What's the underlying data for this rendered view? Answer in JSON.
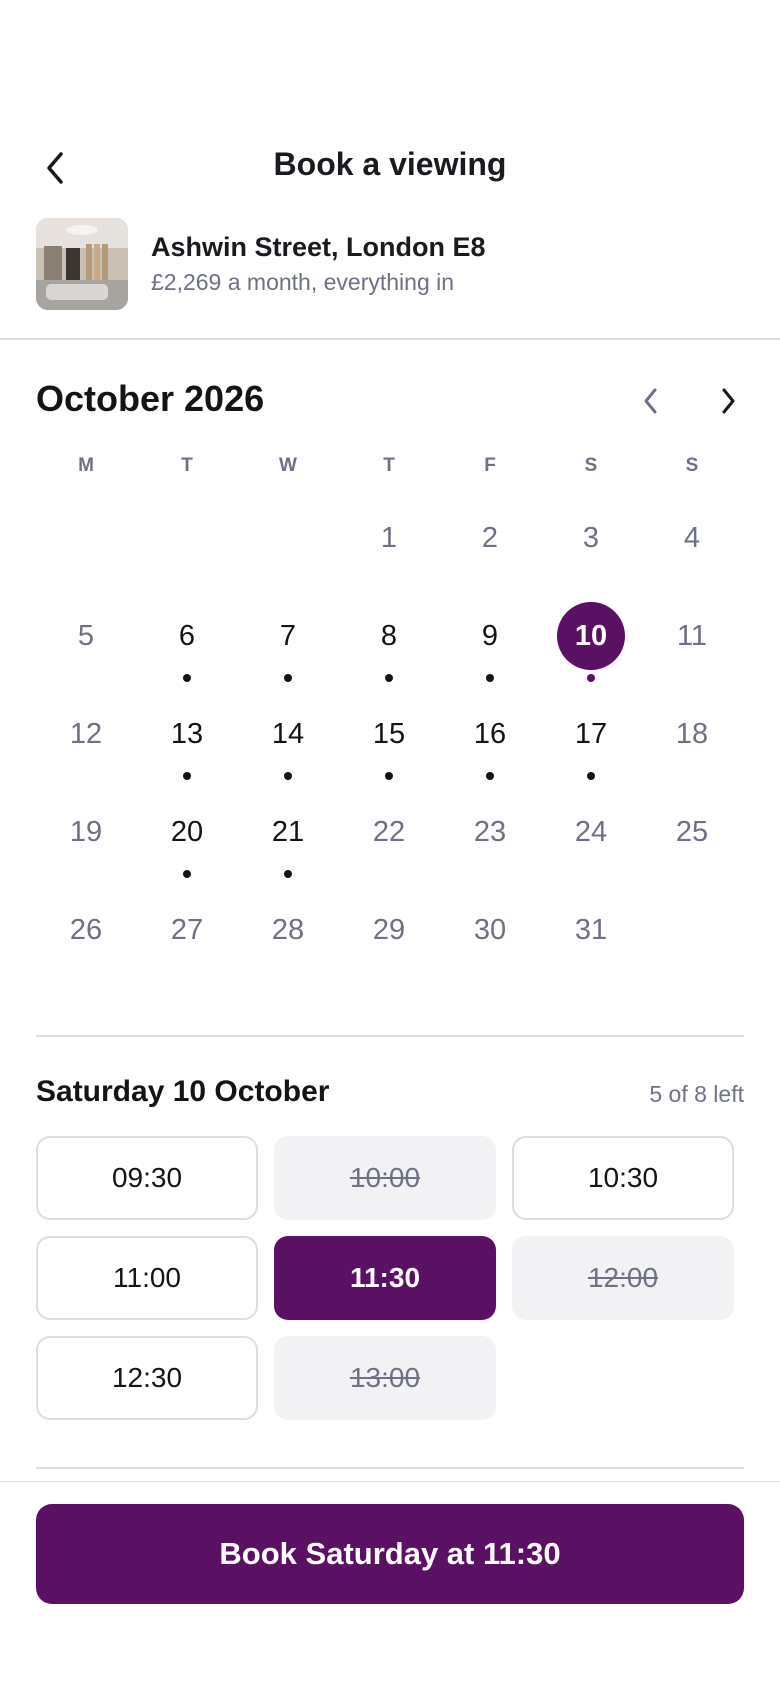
{
  "header": {
    "title": "Book a viewing"
  },
  "listing": {
    "title": "Ashwin Street, London E8",
    "subtitle": "£2,269 a month, everything in"
  },
  "calendar": {
    "month_label": "October 2026",
    "weekdays": [
      "M",
      "T",
      "W",
      "T",
      "F",
      "S",
      "S"
    ],
    "weeks": [
      [
        null,
        null,
        null,
        {
          "n": "1",
          "s": "muted"
        },
        {
          "n": "2",
          "s": "muted"
        },
        {
          "n": "3",
          "s": "muted"
        },
        {
          "n": "4",
          "s": "muted"
        }
      ],
      [
        {
          "n": "5",
          "s": "muted"
        },
        {
          "n": "6",
          "s": "avail"
        },
        {
          "n": "7",
          "s": "avail"
        },
        {
          "n": "8",
          "s": "avail"
        },
        {
          "n": "9",
          "s": "avail"
        },
        {
          "n": "10",
          "s": "selected"
        },
        {
          "n": "11",
          "s": "muted"
        }
      ],
      [
        {
          "n": "12",
          "s": "muted"
        },
        {
          "n": "13",
          "s": "avail"
        },
        {
          "n": "14",
          "s": "avail"
        },
        {
          "n": "15",
          "s": "avail"
        },
        {
          "n": "16",
          "s": "avail"
        },
        {
          "n": "17",
          "s": "avail"
        },
        {
          "n": "18",
          "s": "muted"
        }
      ],
      [
        {
          "n": "19",
          "s": "muted"
        },
        {
          "n": "20",
          "s": "avail"
        },
        {
          "n": "21",
          "s": "avail"
        },
        {
          "n": "22",
          "s": "muted"
        },
        {
          "n": "23",
          "s": "muted"
        },
        {
          "n": "24",
          "s": "muted"
        },
        {
          "n": "25",
          "s": "muted"
        }
      ],
      [
        {
          "n": "26",
          "s": "muted"
        },
        {
          "n": "27",
          "s": "muted"
        },
        {
          "n": "28",
          "s": "muted"
        },
        {
          "n": "29",
          "s": "muted"
        },
        {
          "n": "30",
          "s": "muted"
        },
        {
          "n": "31",
          "s": "muted"
        },
        null
      ]
    ]
  },
  "slots_section": {
    "date_label": "Saturday 10 October",
    "availability_label": "5 of 8 left",
    "slots": [
      {
        "time": "09:30",
        "state": "open"
      },
      {
        "time": "10:00",
        "state": "taken"
      },
      {
        "time": "10:30",
        "state": "open"
      },
      {
        "time": "11:00",
        "state": "open"
      },
      {
        "time": "11:30",
        "state": "chosen"
      },
      {
        "time": "12:00",
        "state": "taken"
      },
      {
        "time": "12:30",
        "state": "open"
      },
      {
        "time": "13:00",
        "state": "taken"
      }
    ]
  },
  "cta": {
    "label": "Book Saturday at 11:30"
  },
  "icons": {
    "back": "chevron-left-icon",
    "prev_month": "chevron-left-icon",
    "next_month": "chevron-right-icon"
  },
  "colors": {
    "accent": "#5b1163",
    "muted_text": "#6e7185",
    "border": "#dcdde2",
    "taken_bg": "#f2f2f5"
  }
}
